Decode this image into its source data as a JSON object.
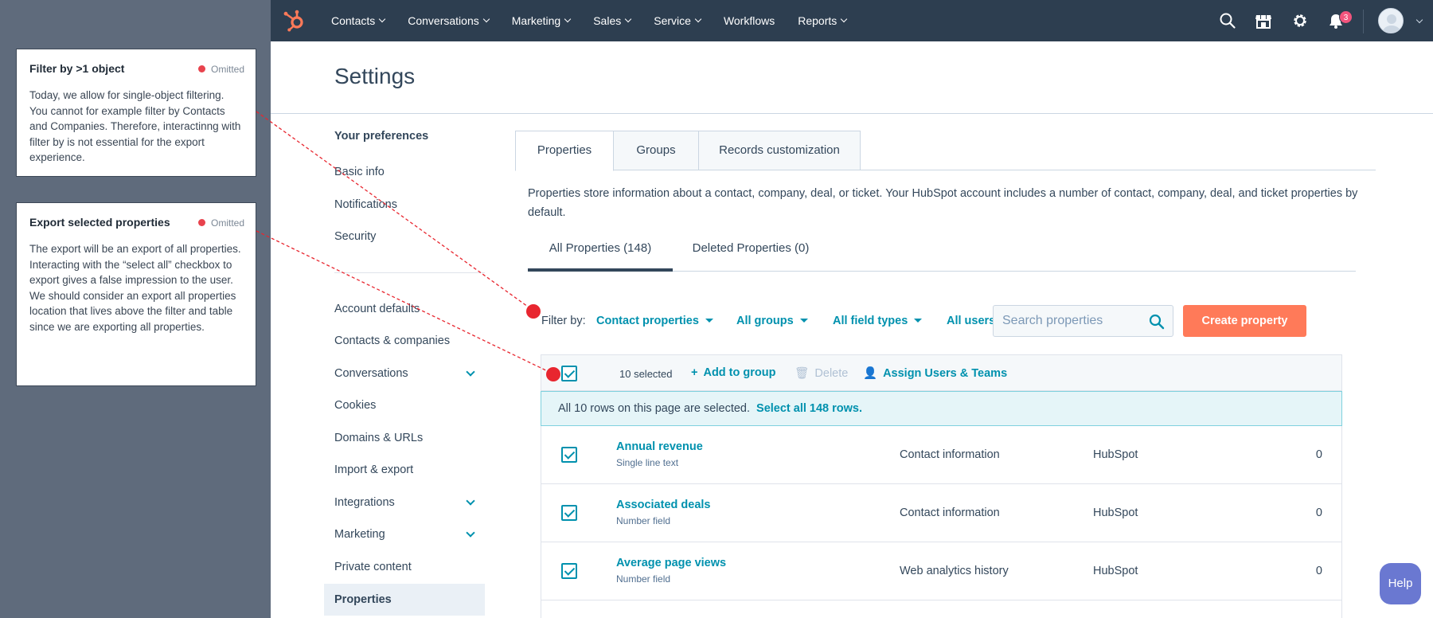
{
  "annotations": [
    {
      "title": "Filter by >1 object",
      "status": "Omitted",
      "body": "Today, we allow for single-object filtering. You cannot for example filter by Contacts and Companies. Therefore, interactinng with filter by is not essential for the export experience."
    },
    {
      "title": "Export selected properties",
      "status": "Omitted",
      "body": "The export will be an export of all properties. Interacting with the “select all” checkbox to export gives a false impression to the user. We should consider an export all properties location that lives above the filter and table since we are exporting all properties."
    }
  ],
  "colors": {
    "nav_bg": "#2d3e50",
    "accent": "#0091ae",
    "primary_button": "#ff7a59",
    "annotation_marker": "#e8262f",
    "help_button": "#6a78d1"
  },
  "topnav": {
    "items": [
      "Contacts",
      "Conversations",
      "Marketing",
      "Sales",
      "Service",
      "Workflows",
      "Reports"
    ],
    "notification_count": "3"
  },
  "page": {
    "title": "Settings"
  },
  "menu": {
    "section_title": "Your preferences",
    "preferences": [
      "Basic info",
      "Notifications",
      "Security"
    ],
    "account": [
      "Account defaults",
      "Contacts & companies",
      "Conversations",
      "Cookies",
      "Domains & URLs",
      "Import & export",
      "Integrations",
      "Marketing",
      "Private content",
      "Properties"
    ],
    "active": "Properties"
  },
  "tabs": [
    "Properties",
    "Groups",
    "Records customization"
  ],
  "description": "Properties store information about a contact, company, deal, or ticket. Your HubSpot account includes a number of contact, company, deal, and ticket properties by default.",
  "subtabs": [
    "All Properties (148)",
    "Deleted Properties (0)"
  ],
  "filter": {
    "label": "Filter by:",
    "object": "Contact properties",
    "groups": "All groups",
    "field_types": "All field types",
    "users": "All users",
    "search_placeholder": "Search properties",
    "create_button": "Create property"
  },
  "bulk": {
    "selected_count": "10 selected",
    "add_to_group": "Add to group",
    "delete": "Delete",
    "assign": "Assign Users & Teams",
    "banner_text": "All 10 rows on this page are selected.",
    "banner_link": "Select all 148 rows."
  },
  "rows": [
    {
      "name": "Annual revenue",
      "type": "Single line text",
      "group": "Contact information",
      "created_by": "HubSpot",
      "used_in": "0"
    },
    {
      "name": "Associated deals",
      "type": "Number field",
      "group": "Contact information",
      "created_by": "HubSpot",
      "used_in": "0"
    },
    {
      "name": "Average page views",
      "type": "Number field",
      "group": "Web analytics history",
      "created_by": "HubSpot",
      "used_in": "0"
    }
  ],
  "help": {
    "label": "Help"
  }
}
